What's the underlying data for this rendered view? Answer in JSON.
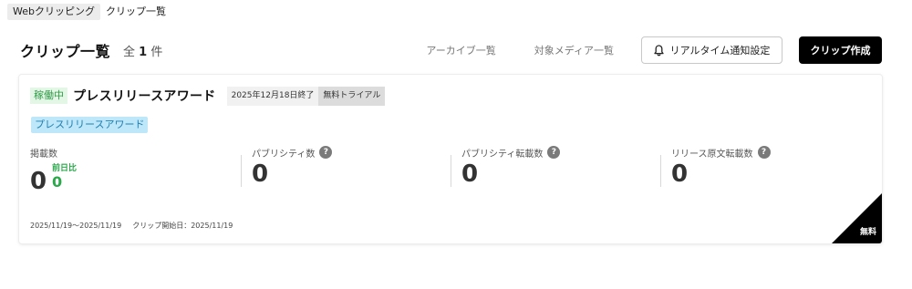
{
  "breadcrumb": {
    "items": [
      "Webクリッピング",
      "クリップ一覧"
    ]
  },
  "header": {
    "title": "クリップ一覧",
    "total_prefix": "全",
    "total_count": "1",
    "total_suffix": "件",
    "links": {
      "archive": "アーカイブ一覧",
      "media": "対象メディア一覧"
    },
    "notify_button": "リアルタイム通知設定",
    "create_button": "クリップ作成"
  },
  "clip": {
    "status": "稼働中",
    "name": "プレスリリースアワード",
    "end_date": "2025年12月18日終了",
    "plan": "無料トライアル",
    "tag": "プレスリリースアワード",
    "stats": [
      {
        "label": "掲載数",
        "value": "0",
        "diff_label": "前日比",
        "diff_value": "0"
      },
      {
        "label": "パブリシティ数",
        "value": "0",
        "help": "?"
      },
      {
        "label": "パブリシティ転載数",
        "value": "0",
        "help": "?"
      },
      {
        "label": "リリース原文転載数",
        "value": "0",
        "help": "?"
      }
    ],
    "period": "2025/11/19〜2025/11/19",
    "start_label": "クリップ開始日：2025/11/19",
    "corner_label": "無料"
  },
  "icons": {
    "notify": "bell-icon",
    "help": "help-icon"
  },
  "colors": {
    "status_bg": "#e4f6e6",
    "status_text": "#2f9a46",
    "tag_bg": "#bfe7fa",
    "diff": "#2aa84a",
    "primary_button": "#000000"
  }
}
